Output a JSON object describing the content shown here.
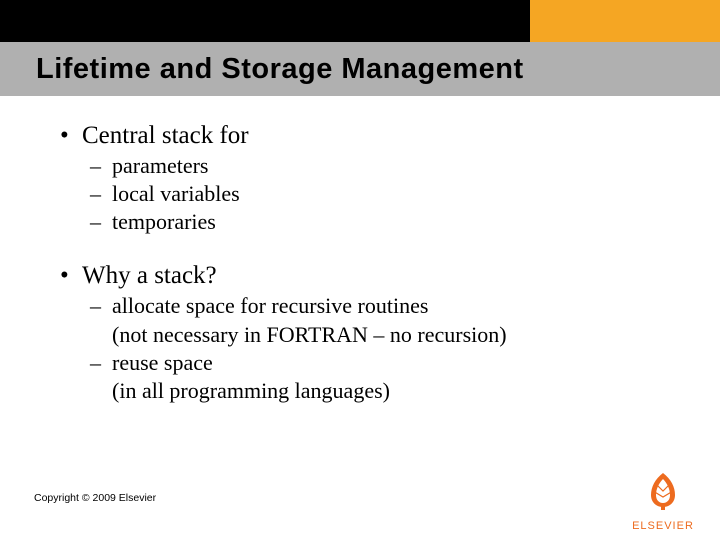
{
  "colors": {
    "accent_orange": "#f5a623",
    "title_bg": "#b0b0b0",
    "logo_orange": "#ed6b1f"
  },
  "title": "Lifetime and Storage Management",
  "bullets": [
    {
      "text": "Central stack for",
      "subs": [
        {
          "text": "parameters"
        },
        {
          "text": "local variables"
        },
        {
          "text": "temporaries"
        }
      ]
    },
    {
      "text": "Why a stack?",
      "subs": [
        {
          "text": "allocate space for recursive routines",
          "cont": "(not necessary in FORTRAN – no recursion)"
        },
        {
          "text": "reuse space",
          "cont": "(in all programming languages)"
        }
      ]
    }
  ],
  "copyright": "Copyright © 2009 Elsevier",
  "logo_text": "ELSEVIER"
}
